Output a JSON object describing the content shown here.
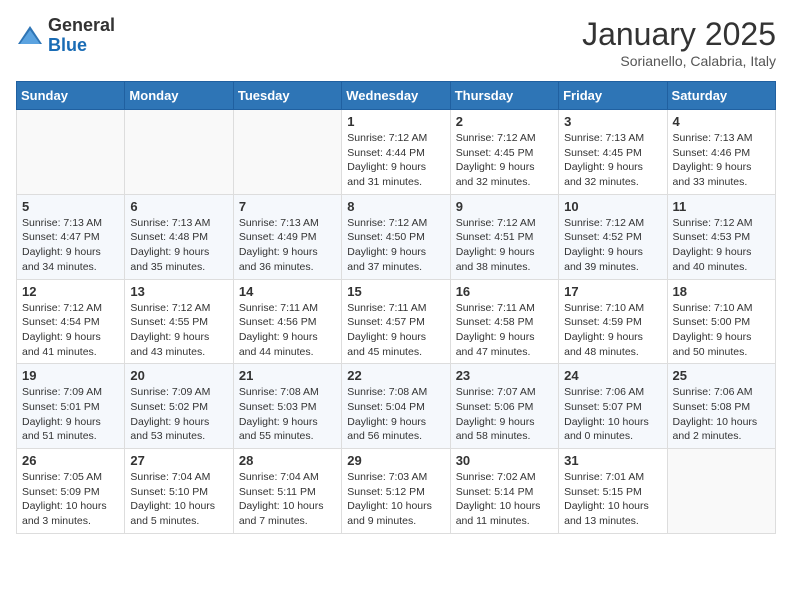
{
  "header": {
    "logo_general": "General",
    "logo_blue": "Blue",
    "month_title": "January 2025",
    "location": "Sorianello, Calabria, Italy"
  },
  "weekdays": [
    "Sunday",
    "Monday",
    "Tuesday",
    "Wednesday",
    "Thursday",
    "Friday",
    "Saturday"
  ],
  "weeks": [
    [
      {
        "day": "",
        "info": ""
      },
      {
        "day": "",
        "info": ""
      },
      {
        "day": "",
        "info": ""
      },
      {
        "day": "1",
        "info": "Sunrise: 7:12 AM\nSunset: 4:44 PM\nDaylight: 9 hours and 31 minutes."
      },
      {
        "day": "2",
        "info": "Sunrise: 7:12 AM\nSunset: 4:45 PM\nDaylight: 9 hours and 32 minutes."
      },
      {
        "day": "3",
        "info": "Sunrise: 7:13 AM\nSunset: 4:45 PM\nDaylight: 9 hours and 32 minutes."
      },
      {
        "day": "4",
        "info": "Sunrise: 7:13 AM\nSunset: 4:46 PM\nDaylight: 9 hours and 33 minutes."
      }
    ],
    [
      {
        "day": "5",
        "info": "Sunrise: 7:13 AM\nSunset: 4:47 PM\nDaylight: 9 hours and 34 minutes."
      },
      {
        "day": "6",
        "info": "Sunrise: 7:13 AM\nSunset: 4:48 PM\nDaylight: 9 hours and 35 minutes."
      },
      {
        "day": "7",
        "info": "Sunrise: 7:13 AM\nSunset: 4:49 PM\nDaylight: 9 hours and 36 minutes."
      },
      {
        "day": "8",
        "info": "Sunrise: 7:12 AM\nSunset: 4:50 PM\nDaylight: 9 hours and 37 minutes."
      },
      {
        "day": "9",
        "info": "Sunrise: 7:12 AM\nSunset: 4:51 PM\nDaylight: 9 hours and 38 minutes."
      },
      {
        "day": "10",
        "info": "Sunrise: 7:12 AM\nSunset: 4:52 PM\nDaylight: 9 hours and 39 minutes."
      },
      {
        "day": "11",
        "info": "Sunrise: 7:12 AM\nSunset: 4:53 PM\nDaylight: 9 hours and 40 minutes."
      }
    ],
    [
      {
        "day": "12",
        "info": "Sunrise: 7:12 AM\nSunset: 4:54 PM\nDaylight: 9 hours and 41 minutes."
      },
      {
        "day": "13",
        "info": "Sunrise: 7:12 AM\nSunset: 4:55 PM\nDaylight: 9 hours and 43 minutes."
      },
      {
        "day": "14",
        "info": "Sunrise: 7:11 AM\nSunset: 4:56 PM\nDaylight: 9 hours and 44 minutes."
      },
      {
        "day": "15",
        "info": "Sunrise: 7:11 AM\nSunset: 4:57 PM\nDaylight: 9 hours and 45 minutes."
      },
      {
        "day": "16",
        "info": "Sunrise: 7:11 AM\nSunset: 4:58 PM\nDaylight: 9 hours and 47 minutes."
      },
      {
        "day": "17",
        "info": "Sunrise: 7:10 AM\nSunset: 4:59 PM\nDaylight: 9 hours and 48 minutes."
      },
      {
        "day": "18",
        "info": "Sunrise: 7:10 AM\nSunset: 5:00 PM\nDaylight: 9 hours and 50 minutes."
      }
    ],
    [
      {
        "day": "19",
        "info": "Sunrise: 7:09 AM\nSunset: 5:01 PM\nDaylight: 9 hours and 51 minutes."
      },
      {
        "day": "20",
        "info": "Sunrise: 7:09 AM\nSunset: 5:02 PM\nDaylight: 9 hours and 53 minutes."
      },
      {
        "day": "21",
        "info": "Sunrise: 7:08 AM\nSunset: 5:03 PM\nDaylight: 9 hours and 55 minutes."
      },
      {
        "day": "22",
        "info": "Sunrise: 7:08 AM\nSunset: 5:04 PM\nDaylight: 9 hours and 56 minutes."
      },
      {
        "day": "23",
        "info": "Sunrise: 7:07 AM\nSunset: 5:06 PM\nDaylight: 9 hours and 58 minutes."
      },
      {
        "day": "24",
        "info": "Sunrise: 7:06 AM\nSunset: 5:07 PM\nDaylight: 10 hours and 0 minutes."
      },
      {
        "day": "25",
        "info": "Sunrise: 7:06 AM\nSunset: 5:08 PM\nDaylight: 10 hours and 2 minutes."
      }
    ],
    [
      {
        "day": "26",
        "info": "Sunrise: 7:05 AM\nSunset: 5:09 PM\nDaylight: 10 hours and 3 minutes."
      },
      {
        "day": "27",
        "info": "Sunrise: 7:04 AM\nSunset: 5:10 PM\nDaylight: 10 hours and 5 minutes."
      },
      {
        "day": "28",
        "info": "Sunrise: 7:04 AM\nSunset: 5:11 PM\nDaylight: 10 hours and 7 minutes."
      },
      {
        "day": "29",
        "info": "Sunrise: 7:03 AM\nSunset: 5:12 PM\nDaylight: 10 hours and 9 minutes."
      },
      {
        "day": "30",
        "info": "Sunrise: 7:02 AM\nSunset: 5:14 PM\nDaylight: 10 hours and 11 minutes."
      },
      {
        "day": "31",
        "info": "Sunrise: 7:01 AM\nSunset: 5:15 PM\nDaylight: 10 hours and 13 minutes."
      },
      {
        "day": "",
        "info": ""
      }
    ]
  ]
}
